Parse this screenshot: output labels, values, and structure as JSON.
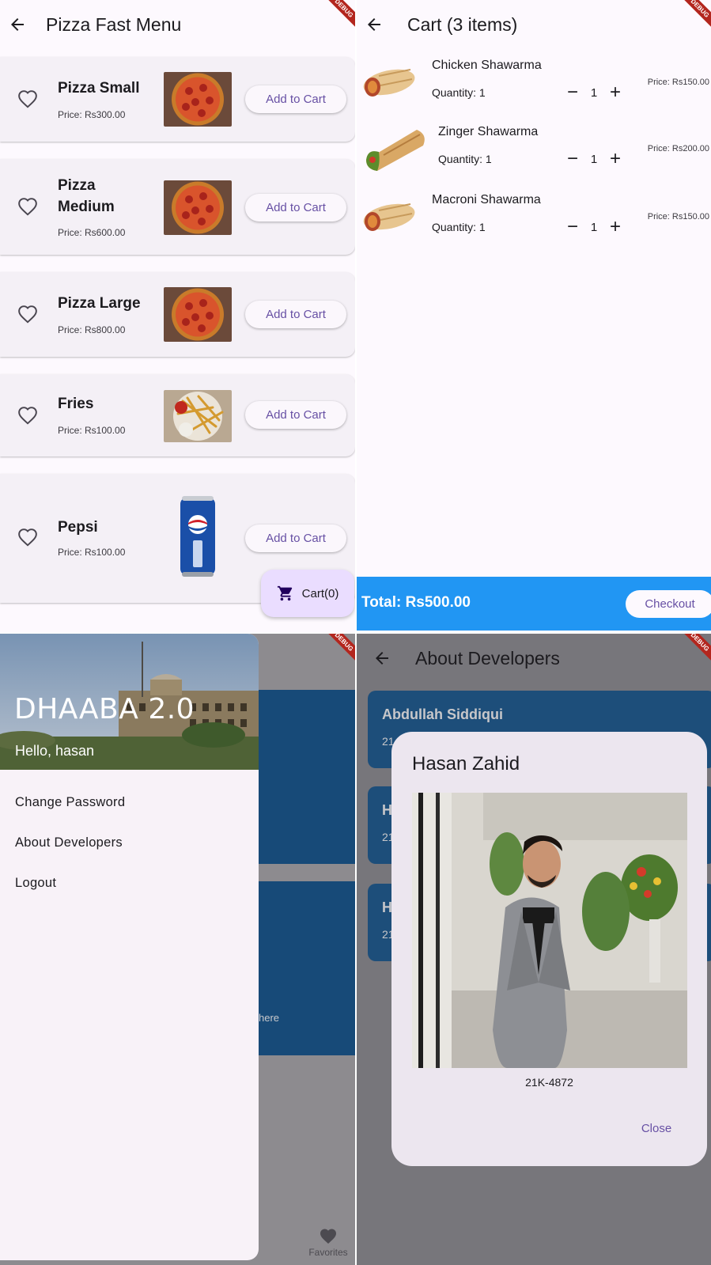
{
  "menu_screen": {
    "title": "Pizza Fast Menu",
    "add_label": "Add to Cart",
    "items": [
      {
        "name": "Pizza Small",
        "price": "Price: Rs300.00"
      },
      {
        "name": "Pizza Medium",
        "price": "Price: Rs600.00"
      },
      {
        "name": "Pizza Large",
        "price": "Price: Rs800.00"
      },
      {
        "name": "Fries",
        "price": "Price: Rs100.00"
      },
      {
        "name": "Pepsi",
        "price": "Price: Rs100.00"
      }
    ],
    "cart_fab": "Cart(0)"
  },
  "cart_screen": {
    "title": "Cart (3 items)",
    "items": [
      {
        "name": "Chicken Shawarma",
        "quantity": "Quantity: 1",
        "count": "1",
        "price": "Price: Rs150.00"
      },
      {
        "name": "Zinger Shawarma",
        "quantity": "Quantity: 1",
        "count": "1",
        "price": "Price: Rs200.00"
      },
      {
        "name": "Macroni Shawarma",
        "quantity": "Quantity: 1",
        "count": "1",
        "price": "Price: Rs150.00"
      }
    ],
    "total": "Total: Rs500.00",
    "checkout": "Checkout"
  },
  "drawer_screen": {
    "app_name": "DHAABA 2.0",
    "greeting": "Hello, hasan",
    "items": [
      "Change Password",
      "About Developers",
      "Logout"
    ],
    "behind_text": "here",
    "favorites": "Favorites"
  },
  "about_screen": {
    "title": "About Developers",
    "cards": [
      {
        "name": "Abdullah Siddiqui",
        "sub": "21"
      },
      {
        "name": "H",
        "sub": "21"
      },
      {
        "name": "H",
        "sub": "21"
      }
    ],
    "dialog": {
      "name": "Hasan Zahid",
      "id": "21K-4872",
      "close": "Close"
    }
  },
  "colors": {
    "accent": "#6750a4",
    "total_bar": "#2196f3",
    "fab": "#eaddff"
  }
}
